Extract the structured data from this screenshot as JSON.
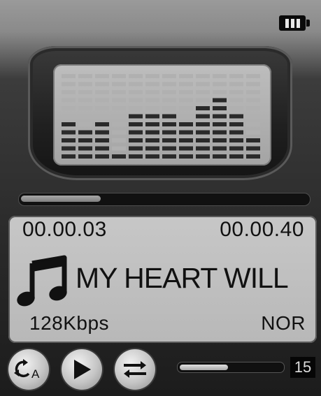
{
  "status": {
    "battery_icon": "battery-full-icon",
    "battery_bars": 3
  },
  "visualizer": {
    "type": "equalizer-bars",
    "levels": [
      5,
      4,
      5,
      1,
      6,
      6,
      6,
      5,
      7,
      8,
      6,
      3
    ],
    "max_level": 11
  },
  "playback": {
    "elapsed": "00.00.03",
    "total": "00.00.40",
    "progress_fraction": 0.28
  },
  "track": {
    "title": "MY HEART WILL",
    "icon": "music-note-icon"
  },
  "info": {
    "bitrate": "128Kbps",
    "eq_mode": "NOR"
  },
  "controls": {
    "repeat_label": "A",
    "repeat_icon": "repeat-icon",
    "play_icon": "play-icon",
    "shuffle_icon": "shuffle-icon"
  },
  "volume": {
    "level": "15",
    "fraction": 0.48
  },
  "colors": {
    "panel_bg": "#c2c2c2",
    "text": "#111111",
    "bar_dark": "#2a2a2a"
  }
}
